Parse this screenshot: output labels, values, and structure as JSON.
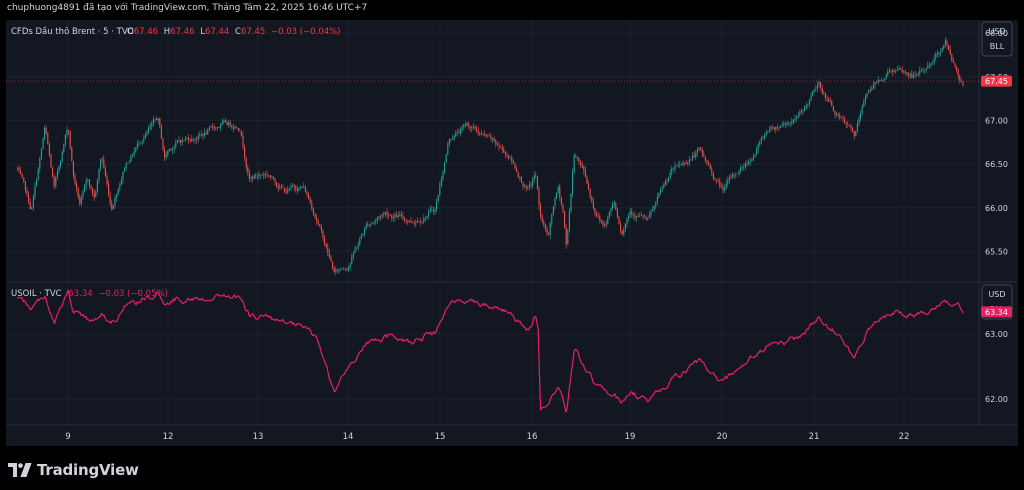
{
  "header": {
    "text": "chuphuong4891 đã tạo với TradingView.com, Tháng Tám 22, 2025 16:46 UTC+7"
  },
  "footer": {
    "logo_text": "TradingView"
  },
  "colors": {
    "background": "#131722",
    "grid": "#1e222d",
    "text": "#d1d4dc",
    "muted": "#b2b5be",
    "up": "#26a69a",
    "down": "#ef5350",
    "usoil_line": "#e91e63",
    "last_price_brent": "#f23645",
    "last_price_usoil": "#e91e63"
  },
  "chart_data": [
    {
      "type": "candlestick",
      "legend": {
        "symbol": "CFDs Dầu thô Brent · 5 · TVC",
        "o_label": "O",
        "o_value": "67.46",
        "h_label": "H",
        "h_value": "67.46",
        "l_label": "L",
        "l_value": "67.44",
        "c_label": "C",
        "c_value": "67.45",
        "change": "−0.03 (−0.04%)"
      },
      "currency": "USD",
      "unit": "BLL",
      "last_price": 67.45,
      "last_price_label": "67.45",
      "ylim": [
        65.15,
        68.15
      ],
      "y_ticks": [
        "68.00",
        "67.50",
        "67.00",
        "66.50",
        "66.00",
        "65.50"
      ],
      "y_tick_values": [
        68.0,
        67.5,
        67.0,
        66.5,
        66.0,
        65.5
      ],
      "waypoints": [
        {
          "d": 8.45,
          "v": 66.45
        },
        {
          "d": 8.6,
          "v": 65.95
        },
        {
          "d": 8.75,
          "v": 66.9
        },
        {
          "d": 8.85,
          "v": 66.2
        },
        {
          "d": 9.0,
          "v": 66.95
        },
        {
          "d": 9.15,
          "v": 66.4
        },
        {
          "d": 9.35,
          "v": 66.05
        },
        {
          "d": 9.6,
          "v": 66.3
        },
        {
          "d": 9.8,
          "v": 66.1
        },
        {
          "d": 10.0,
          "v": 66.6
        },
        {
          "d": 10.3,
          "v": 66.0
        },
        {
          "d": 10.7,
          "v": 66.5
        },
        {
          "d": 11.2,
          "v": 66.8
        },
        {
          "d": 11.7,
          "v": 67.0
        },
        {
          "d": 11.9,
          "v": 66.55
        },
        {
          "d": 12.1,
          "v": 66.75
        },
        {
          "d": 12.4,
          "v": 66.85
        },
        {
          "d": 12.6,
          "v": 66.95
        },
        {
          "d": 12.8,
          "v": 66.95
        },
        {
          "d": 12.9,
          "v": 66.35
        },
        {
          "d": 13.1,
          "v": 66.4
        },
        {
          "d": 13.3,
          "v": 66.2
        },
        {
          "d": 13.5,
          "v": 66.25
        },
        {
          "d": 13.65,
          "v": 65.9
        },
        {
          "d": 13.85,
          "v": 65.25
        },
        {
          "d": 14.0,
          "v": 65.35
        },
        {
          "d": 14.2,
          "v": 65.8
        },
        {
          "d": 14.4,
          "v": 65.95
        },
        {
          "d": 14.7,
          "v": 65.85
        },
        {
          "d": 14.95,
          "v": 66.0
        },
        {
          "d": 15.1,
          "v": 66.8
        },
        {
          "d": 15.3,
          "v": 66.95
        },
        {
          "d": 15.5,
          "v": 66.8
        },
        {
          "d": 15.75,
          "v": 66.6
        },
        {
          "d": 15.95,
          "v": 66.2
        },
        {
          "d": 16.1,
          "v": 66.4
        },
        {
          "d": 16.25,
          "v": 65.9
        },
        {
          "d": 16.5,
          "v": 65.65
        },
        {
          "d": 16.65,
          "v": 66.0
        },
        {
          "d": 16.8,
          "v": 66.2
        },
        {
          "d": 16.95,
          "v": 65.95
        },
        {
          "d": 17.05,
          "v": 65.55
        },
        {
          "d": 17.3,
          "v": 66.65
        },
        {
          "d": 17.6,
          "v": 66.4
        },
        {
          "d": 17.9,
          "v": 66.0
        },
        {
          "d": 18.2,
          "v": 65.8
        },
        {
          "d": 18.5,
          "v": 66.1
        },
        {
          "d": 18.75,
          "v": 65.75
        },
        {
          "d": 19.0,
          "v": 66.0
        },
        {
          "d": 19.2,
          "v": 65.85
        },
        {
          "d": 19.45,
          "v": 66.4
        },
        {
          "d": 19.75,
          "v": 66.65
        },
        {
          "d": 20.0,
          "v": 66.2
        },
        {
          "d": 20.3,
          "v": 66.55
        },
        {
          "d": 20.5,
          "v": 66.9
        },
        {
          "d": 20.85,
          "v": 67.05
        },
        {
          "d": 21.05,
          "v": 67.4
        },
        {
          "d": 21.3,
          "v": 67.0
        },
        {
          "d": 21.45,
          "v": 66.8
        },
        {
          "d": 21.6,
          "v": 67.35
        },
        {
          "d": 21.85,
          "v": 67.6
        },
        {
          "d": 22.1,
          "v": 67.5
        },
        {
          "d": 22.3,
          "v": 67.65
        },
        {
          "d": 22.45,
          "v": 67.9
        },
        {
          "d": 22.6,
          "v": 67.5
        },
        {
          "d": 22.65,
          "v": 67.45
        }
      ]
    },
    {
      "type": "line",
      "legend": {
        "symbol": "USOIL · TVC",
        "value": "63.34",
        "change": "−0.03 (−0.05%)"
      },
      "currency": "USD",
      "unit": "BLL",
      "last_price": 63.34,
      "last_price_label": "63.34",
      "ylim": [
        61.6,
        63.8
      ],
      "y_ticks": [
        "63.00",
        "62.00"
      ],
      "y_tick_values": [
        63.0,
        62.0
      ],
      "waypoints": [
        {
          "d": 8.45,
          "v": 63.55
        },
        {
          "d": 8.6,
          "v": 63.4
        },
        {
          "d": 8.75,
          "v": 63.6
        },
        {
          "d": 8.85,
          "v": 63.15
        },
        {
          "d": 9.0,
          "v": 63.65
        },
        {
          "d": 9.15,
          "v": 63.3
        },
        {
          "d": 9.35,
          "v": 63.35
        },
        {
          "d": 9.6,
          "v": 63.2
        },
        {
          "d": 9.8,
          "v": 63.25
        },
        {
          "d": 10.0,
          "v": 63.35
        },
        {
          "d": 10.3,
          "v": 63.15
        },
        {
          "d": 10.7,
          "v": 63.4
        },
        {
          "d": 11.2,
          "v": 63.5
        },
        {
          "d": 11.7,
          "v": 63.65
        },
        {
          "d": 11.9,
          "v": 63.45
        },
        {
          "d": 12.1,
          "v": 63.55
        },
        {
          "d": 12.4,
          "v": 63.55
        },
        {
          "d": 12.6,
          "v": 63.6
        },
        {
          "d": 12.8,
          "v": 63.55
        },
        {
          "d": 12.9,
          "v": 63.3
        },
        {
          "d": 13.1,
          "v": 63.25
        },
        {
          "d": 13.3,
          "v": 63.15
        },
        {
          "d": 13.5,
          "v": 63.1
        },
        {
          "d": 13.65,
          "v": 62.95
        },
        {
          "d": 13.85,
          "v": 62.1
        },
        {
          "d": 14.0,
          "v": 62.5
        },
        {
          "d": 14.2,
          "v": 62.85
        },
        {
          "d": 14.4,
          "v": 62.95
        },
        {
          "d": 14.7,
          "v": 62.9
        },
        {
          "d": 14.95,
          "v": 63.0
        },
        {
          "d": 15.1,
          "v": 63.45
        },
        {
          "d": 15.3,
          "v": 63.55
        },
        {
          "d": 15.5,
          "v": 63.45
        },
        {
          "d": 15.75,
          "v": 63.35
        },
        {
          "d": 15.95,
          "v": 63.05
        },
        {
          "d": 16.1,
          "v": 63.3
        },
        {
          "d": 16.2,
          "v": 63.05
        },
        {
          "d": 16.25,
          "v": 61.8
        },
        {
          "d": 16.5,
          "v": 61.95
        },
        {
          "d": 16.8,
          "v": 62.2
        },
        {
          "d": 16.95,
          "v": 62.0
        },
        {
          "d": 17.05,
          "v": 61.75
        },
        {
          "d": 17.3,
          "v": 62.75
        },
        {
          "d": 17.6,
          "v": 62.5
        },
        {
          "d": 17.9,
          "v": 62.25
        },
        {
          "d": 18.2,
          "v": 62.15
        },
        {
          "d": 18.5,
          "v": 62.05
        },
        {
          "d": 18.75,
          "v": 61.95
        },
        {
          "d": 19.0,
          "v": 62.1
        },
        {
          "d": 19.2,
          "v": 61.95
        },
        {
          "d": 19.45,
          "v": 62.3
        },
        {
          "d": 19.75,
          "v": 62.55
        },
        {
          "d": 20.0,
          "v": 62.25
        },
        {
          "d": 20.3,
          "v": 62.6
        },
        {
          "d": 20.5,
          "v": 62.8
        },
        {
          "d": 20.85,
          "v": 62.95
        },
        {
          "d": 21.05,
          "v": 63.25
        },
        {
          "d": 21.3,
          "v": 63.0
        },
        {
          "d": 21.45,
          "v": 62.6
        },
        {
          "d": 21.6,
          "v": 63.05
        },
        {
          "d": 21.85,
          "v": 63.35
        },
        {
          "d": 22.1,
          "v": 63.3
        },
        {
          "d": 22.3,
          "v": 63.4
        },
        {
          "d": 22.45,
          "v": 63.55
        },
        {
          "d": 22.6,
          "v": 63.4
        },
        {
          "d": 22.65,
          "v": 63.34
        }
      ]
    }
  ],
  "x_axis": {
    "ticks": [
      "9",
      "12",
      "13",
      "14",
      "15",
      "16",
      "19",
      "20",
      "21",
      "22"
    ],
    "tick_days": [
      9,
      12,
      13,
      14,
      15,
      16,
      19,
      20,
      21,
      22
    ]
  }
}
